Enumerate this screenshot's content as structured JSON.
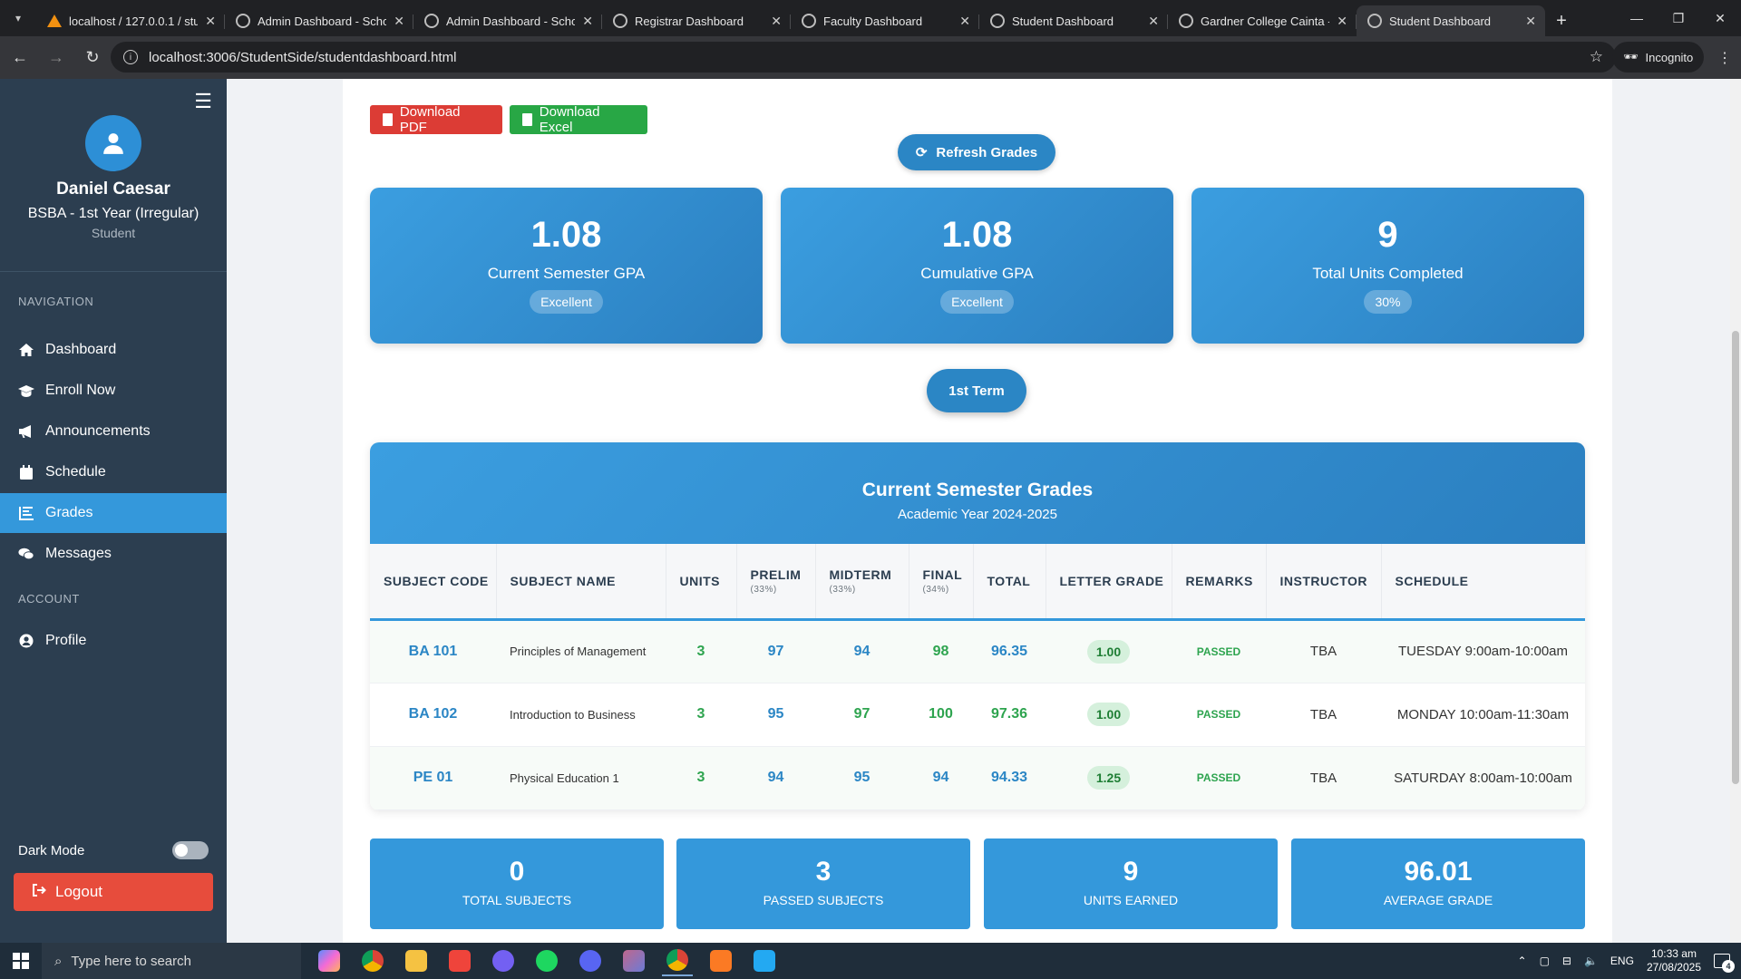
{
  "browser": {
    "tabs": [
      {
        "title": "localhost / 127.0.0.1 / stu",
        "favicon": "phpmyadmin-icon",
        "active": false
      },
      {
        "title": "Admin Dashboard - Scho",
        "favicon": "globe-icon",
        "active": false
      },
      {
        "title": "Admin Dashboard - Scho",
        "favicon": "globe-icon",
        "active": false
      },
      {
        "title": "Registrar Dashboard",
        "favicon": "globe-icon",
        "active": false
      },
      {
        "title": "Faculty Dashboard",
        "favicon": "globe-icon",
        "active": false
      },
      {
        "title": "Student Dashboard",
        "favicon": "globe-icon",
        "active": false
      },
      {
        "title": "Gardner College Cainta -",
        "favicon": "globe-icon",
        "active": false
      },
      {
        "title": "Student Dashboard",
        "favicon": "globe-icon",
        "active": true
      }
    ],
    "url": "localhost:3006/StudentSide/studentdashboard.html",
    "incognito_label": "Incognito"
  },
  "sidebar": {
    "user_name": "Daniel Caesar",
    "program": "BSBA - 1st Year (Irregular)",
    "role": "Student",
    "nav_section": "NAVIGATION",
    "account_section": "ACCOUNT",
    "items": [
      {
        "label": "Dashboard",
        "icon": "home-icon"
      },
      {
        "label": "Enroll Now",
        "icon": "graduation-cap-icon"
      },
      {
        "label": "Announcements",
        "icon": "megaphone-icon"
      },
      {
        "label": "Schedule",
        "icon": "calendar-icon"
      },
      {
        "label": "Grades",
        "icon": "chart-icon",
        "active": true
      },
      {
        "label": "Messages",
        "icon": "chat-icon"
      }
    ],
    "profile_label": "Profile",
    "dark_mode_label": "Dark Mode",
    "logout_label": "Logout"
  },
  "toolbar": {
    "download_pdf": "Download PDF",
    "download_excel": "Download Excel",
    "refresh": "Refresh Grades"
  },
  "stats": [
    {
      "value": "1.08",
      "label": "Current Semester GPA",
      "badge": "Excellent"
    },
    {
      "value": "1.08",
      "label": "Cumulative GPA",
      "badge": "Excellent"
    },
    {
      "value": "9",
      "label": "Total Units Completed",
      "badge": "30%"
    }
  ],
  "term_label": "1st Term",
  "grades": {
    "title": "Current Semester Grades",
    "subtitle": "Academic Year 2024-2025",
    "columns": [
      {
        "label": "SUBJECT CODE",
        "sub": ""
      },
      {
        "label": "SUBJECT NAME",
        "sub": ""
      },
      {
        "label": "UNITS",
        "sub": ""
      },
      {
        "label": "PRELIM",
        "sub": "(33%)"
      },
      {
        "label": "MIDTERM",
        "sub": "(33%)"
      },
      {
        "label": "FINAL",
        "sub": "(34%)"
      },
      {
        "label": "TOTAL",
        "sub": ""
      },
      {
        "label": "LETTER GRADE",
        "sub": ""
      },
      {
        "label": "REMARKS",
        "sub": ""
      },
      {
        "label": "INSTRUCTOR",
        "sub": ""
      },
      {
        "label": "SCHEDULE",
        "sub": ""
      }
    ],
    "rows": [
      {
        "code": "BA 101",
        "name": "Principles of Management",
        "units": "3",
        "prelim": "97",
        "midterm": "94",
        "final": "98",
        "total": "96.35",
        "letter": "1.00",
        "remarks": "PASSED",
        "instructor": "TBA",
        "schedule": "TUESDAY 9:00am-10:00am"
      },
      {
        "code": "BA 102",
        "name": "Introduction to Business",
        "units": "3",
        "prelim": "95",
        "midterm": "97",
        "final": "100",
        "total": "97.36",
        "letter": "1.00",
        "remarks": "PASSED",
        "instructor": "TBA",
        "schedule": "MONDAY 10:00am-11:30am"
      },
      {
        "code": "PE 01",
        "name": "Physical Education 1",
        "units": "3",
        "prelim": "94",
        "midterm": "95",
        "final": "94",
        "total": "94.33",
        "letter": "1.25",
        "remarks": "PASSED",
        "instructor": "TBA",
        "schedule": "SATURDAY 8:00am-10:00am"
      }
    ]
  },
  "summary": [
    {
      "value": "0",
      "label": "TOTAL SUBJECTS"
    },
    {
      "value": "3",
      "label": "PASSED SUBJECTS"
    },
    {
      "value": "9",
      "label": "UNITS EARNED"
    },
    {
      "value": "96.01",
      "label": "AVERAGE GRADE"
    }
  ],
  "taskbar": {
    "search_placeholder": "Type here to search",
    "language": "ENG",
    "time": "10:33 am",
    "date": "27/08/2025",
    "notification_count": "4"
  }
}
